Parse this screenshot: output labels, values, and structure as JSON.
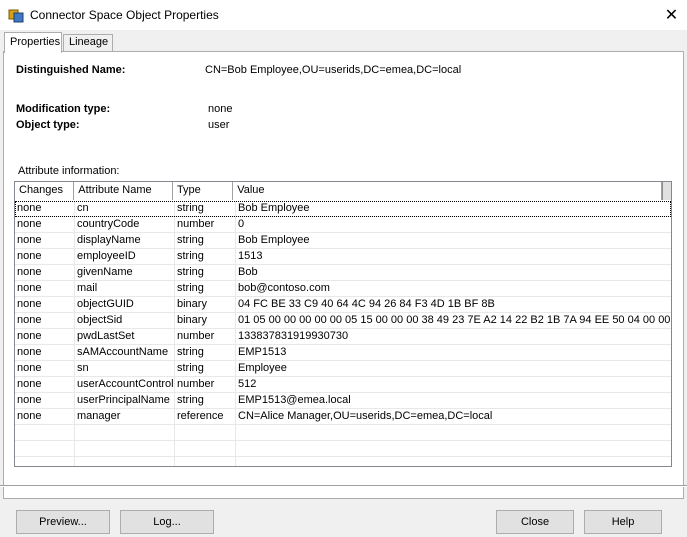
{
  "window": {
    "title": "Connector Space Object Properties",
    "close_glyph": "✕"
  },
  "tabs": [
    {
      "label": "Properties",
      "active": true
    },
    {
      "label": "Lineage",
      "active": false
    }
  ],
  "object": {
    "dn_label": "Distinguished Name:",
    "dn_value": "CN=Bob Employee,OU=userids,DC=emea,DC=local",
    "mod_type_label": "Modification type:",
    "mod_type_value": "none",
    "obj_type_label": "Object type:",
    "obj_type_value": "user",
    "attr_info_label": "Attribute information:"
  },
  "grid": {
    "columns": [
      "Changes",
      "Attribute Name",
      "Type",
      "Value"
    ],
    "rows": [
      [
        "none",
        "cn",
        "string",
        "Bob Employee"
      ],
      [
        "none",
        "countryCode",
        "number",
        "0"
      ],
      [
        "none",
        "displayName",
        "string",
        "Bob Employee"
      ],
      [
        "none",
        "employeeID",
        "string",
        "1513"
      ],
      [
        "none",
        "givenName",
        "string",
        "Bob"
      ],
      [
        "none",
        "mail",
        "string",
        "bob@contoso.com"
      ],
      [
        "none",
        "objectGUID",
        "binary",
        "04 FC BE 33 C9 40 64 4C 94 26 84 F3 4D 1B BF 8B"
      ],
      [
        "none",
        "objectSid",
        "binary",
        "01 05 00 00 00 00 00 05 15 00 00 00 38 49 23 7E A2 14 22 B2 1B 7A 94 EE 50 04 00 00"
      ],
      [
        "none",
        "pwdLastSet",
        "number",
        "133837831919930730"
      ],
      [
        "none",
        "sAMAccountName",
        "string",
        "EMP1513"
      ],
      [
        "none",
        "sn",
        "string",
        "Employee"
      ],
      [
        "none",
        "userAccountControl",
        "number",
        "512"
      ],
      [
        "none",
        "userPrincipalName",
        "string",
        "EMP1513@emea.local"
      ],
      [
        "none",
        "manager",
        "reference",
        "CN=Alice Manager,OU=userids,DC=emea,DC=local"
      ]
    ],
    "empty_rows": 3
  },
  "buttons": {
    "preview": "Preview...",
    "log": "Log...",
    "close": "Close",
    "help": "Help"
  }
}
